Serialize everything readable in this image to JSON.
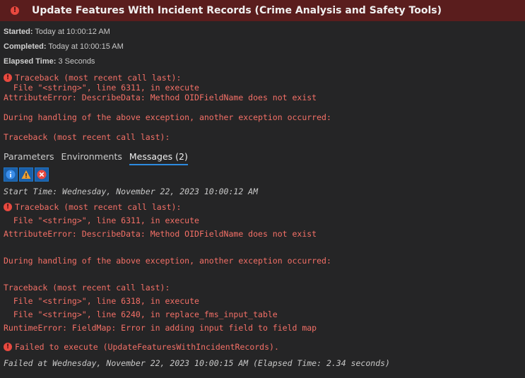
{
  "title": "Update Features With Incident Records (Crime Analysis and Safety Tools)",
  "meta": {
    "started_label": "Started:",
    "started_value": "Today at 10:00:12 AM",
    "completed_label": "Completed:",
    "completed_value": "Today at 10:00:15 AM",
    "elapsed_label": "Elapsed Time:",
    "elapsed_value": "3 Seconds"
  },
  "summary": {
    "line1": "Traceback (most recent call last):",
    "line2": "  File \"<string>\", line 6311, in execute",
    "line3": "AttributeError: DescribeData: Method OIDFieldName does not exist",
    "line4": "During handling of the above exception, another exception occurred:",
    "line5": "Traceback (most recent call last):"
  },
  "tabs": [
    "Parameters",
    "Environments",
    "Messages (2)"
  ],
  "messages": {
    "start_time": "Start Time: Wednesday, November 22, 2023 10:00:12 AM",
    "tb1": "Traceback (most recent call last):",
    "tb2": "  File \"<string>\", line 6311, in execute",
    "tb3": "AttributeError: DescribeData: Method OIDFieldName does not exist",
    "tb4": "During handling of the above exception, another exception occurred:",
    "tb5": "Traceback (most recent call last):",
    "tb6": "  File \"<string>\", line 6318, in execute",
    "tb7": "  File \"<string>\", line 6240, in replace_fms_input_table",
    "tb8": "RuntimeError: FieldMap: Error in adding input field to field map",
    "failed": "Failed to execute (UpdateFeaturesWithIncidentRecords).",
    "failed_at": "Failed at Wednesday, November 22, 2023 10:00:15 AM (Elapsed Time: 2.34 seconds)"
  },
  "colors": {
    "error": "#f47067",
    "title_bg": "#5a1d1d",
    "tab_underline": "#2d8bdf"
  }
}
